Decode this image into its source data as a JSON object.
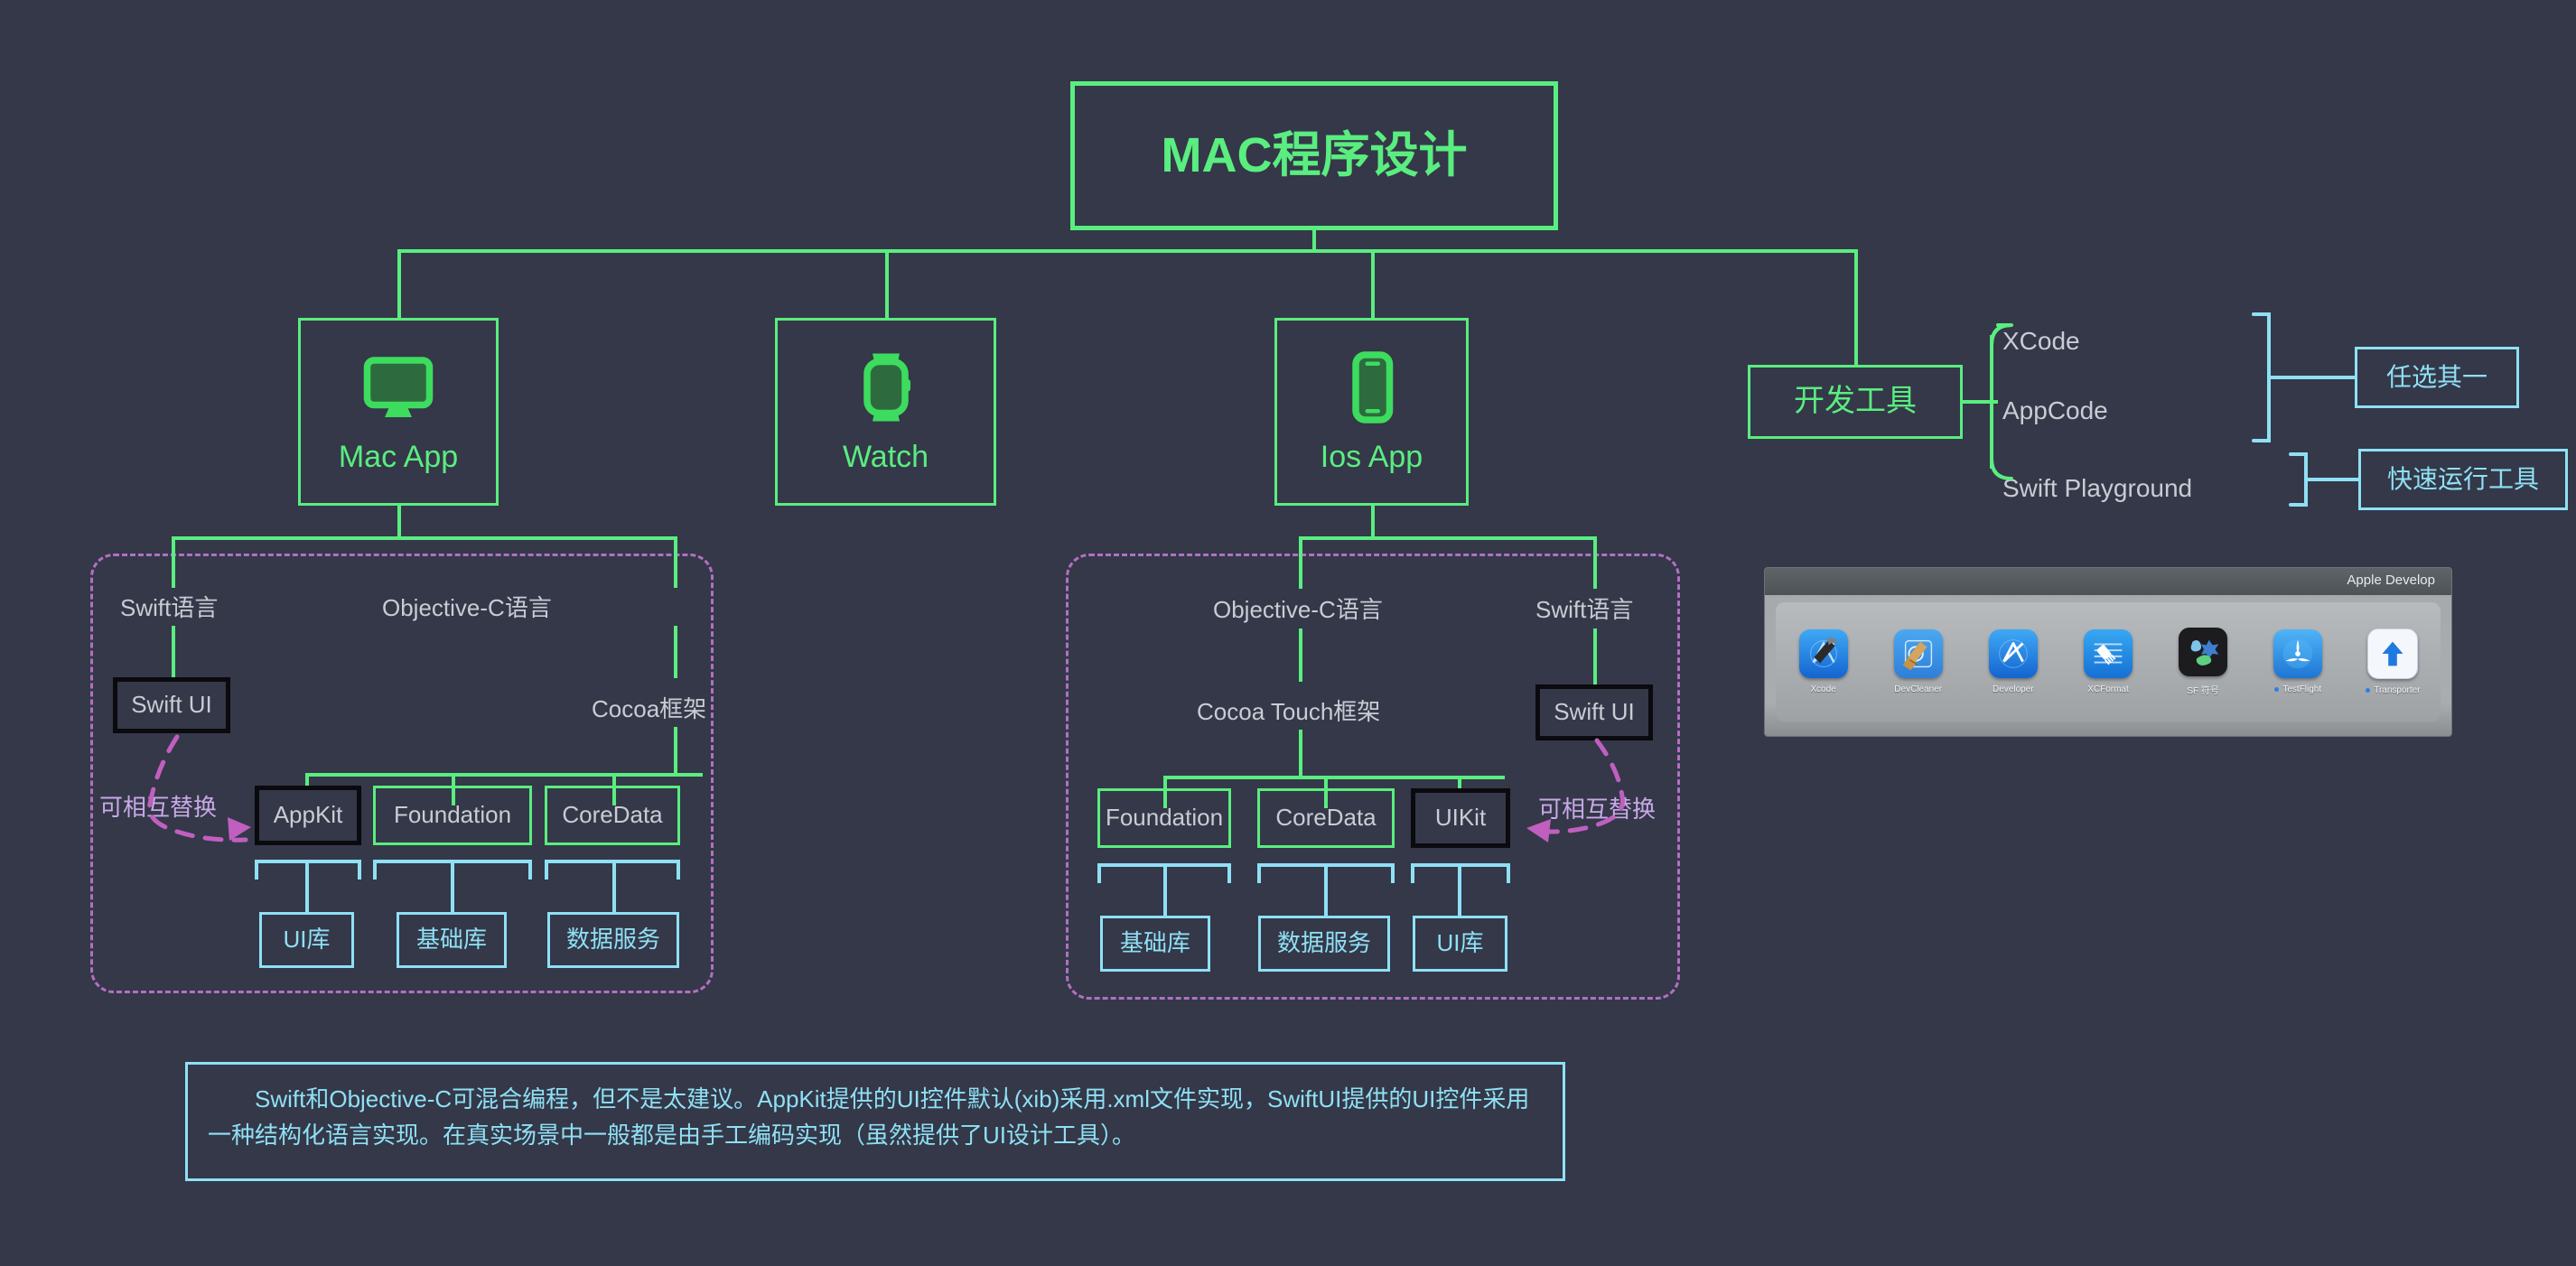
{
  "root": {
    "title": "MAC程序设计"
  },
  "platforms": [
    {
      "id": "mac",
      "label": "Mac App",
      "icon": "monitor-icon"
    },
    {
      "id": "watch",
      "label": "Watch",
      "icon": "watch-icon"
    },
    {
      "id": "ios",
      "label": "Ios App",
      "icon": "phone-icon"
    }
  ],
  "dev_tools": {
    "box_label": "开发工具",
    "tools": [
      "XCode",
      "AppCode",
      "Swift Playground"
    ],
    "groups": [
      {
        "label": "任选其一",
        "members": [
          "XCode",
          "AppCode"
        ]
      },
      {
        "label": "快速运行工具",
        "members": [
          "Swift Playground"
        ]
      }
    ]
  },
  "mac_tree": {
    "languages": [
      "Swift语言",
      "Objective-C语言"
    ],
    "swift_ui": "Swift UI",
    "framework": "Cocoa框架",
    "frameworks": [
      "AppKit",
      "Foundation",
      "CoreData"
    ],
    "libraries": [
      "UI库",
      "基础库",
      "数据服务"
    ],
    "swap_note": "可相互替换"
  },
  "ios_tree": {
    "languages": [
      "Objective-C语言",
      "Swift语言"
    ],
    "swift_ui": "Swift UI",
    "framework": "Cocoa Touch框架",
    "frameworks": [
      "Foundation",
      "CoreData",
      "UIKit"
    ],
    "libraries": [
      "基础库",
      "数据服务",
      "UI库"
    ],
    "swap_note": "可相互替换"
  },
  "dock": {
    "window_title": "Apple Develop",
    "items": [
      {
        "name": "Xcode",
        "icon": "xcode-icon",
        "running": false
      },
      {
        "name": "DevCleaner",
        "icon": "devcleaner-icon",
        "running": false
      },
      {
        "name": "Developer",
        "icon": "developer-icon",
        "running": false
      },
      {
        "name": "XCFormat",
        "icon": "xcformat-icon",
        "running": false
      },
      {
        "name": "SF 符号",
        "icon": "sfsymbols-icon",
        "running": false
      },
      {
        "name": "TestFlight",
        "icon": "testflight-icon",
        "running": true
      },
      {
        "name": "Transporter",
        "icon": "transporter-icon",
        "running": true
      }
    ]
  },
  "note": {
    "text": "Swift和Objective-C可混合编程，但不是太建议。AppKit提供的UI控件默认(xib)采用.xml文件实现，SwiftUI提供的UI控件采用一种结构化语言实现。在真实场景中一般都是由手工编码实现（虽然提供了UI设计工具）。"
  },
  "colors": {
    "background": "#343848",
    "green": "#5aed80",
    "cyan": "#8fe0f5",
    "magenta": "#b36fc4",
    "magenta_text": "#c9a9e8",
    "grey_text": "#c9ccd4",
    "black_border": "#0a0a0f"
  }
}
